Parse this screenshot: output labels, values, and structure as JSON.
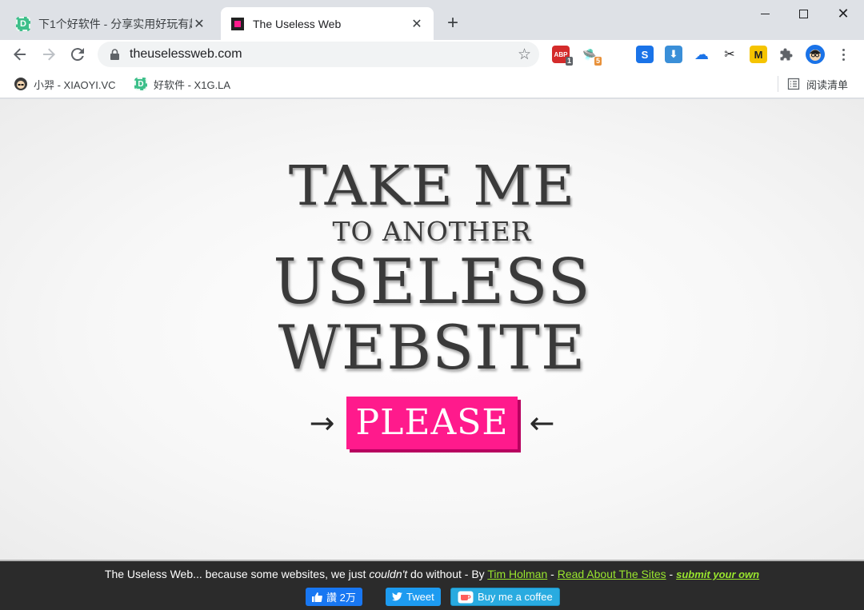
{
  "tabs": [
    {
      "title": "下1个好软件 - 分享实用好玩有趣",
      "active": false
    },
    {
      "title": "The Useless Web",
      "active": true
    }
  ],
  "address_bar": {
    "url": "theuselessweb.com"
  },
  "extensions": [
    {
      "name": "adblock-icon",
      "text": "ABP",
      "badge": "1",
      "color": "#d42b2b"
    },
    {
      "name": "ufo-extension-icon",
      "text": "🛸",
      "badge": "5",
      "color": "#ffffff"
    },
    {
      "name": "monkey-extension-icon",
      "text": "🐵",
      "badge": "",
      "color": "#ffffff"
    },
    {
      "name": "s-extension-icon",
      "text": "S",
      "badge": "",
      "color": "#1a73e8"
    },
    {
      "name": "download-extension-icon",
      "text": "⬇",
      "badge": "",
      "color": "#3a8fd8"
    },
    {
      "name": "cloud-extension-icon",
      "text": "☁",
      "badge": "",
      "color": "#ffffff"
    },
    {
      "name": "scissors-extension-icon",
      "text": "✂",
      "badge": "",
      "color": "#ffffff"
    },
    {
      "name": "m-extension-icon",
      "text": "M",
      "badge": "",
      "color": "#f5c400"
    },
    {
      "name": "puzzle-extensions-icon",
      "text": "🧩",
      "badge": "",
      "color": "#ffffff"
    }
  ],
  "bookmarks": [
    {
      "label": "小羿 - XIAOYI.VC"
    },
    {
      "label": "好软件 - X1G.LA"
    }
  ],
  "reading_list": {
    "label": "阅读清单"
  },
  "page": {
    "line1": "TAKE ME",
    "line2": "TO ANOTHER",
    "line3": "USELESS",
    "line4": "WEBSITE",
    "button": "PLEASE",
    "arrow_left": "→",
    "arrow_right": "←"
  },
  "footer": {
    "text_a": "The Useless Web... because some websites, we just ",
    "text_em": "couldn't",
    "text_b": " do without - By ",
    "author": "Tim Holman",
    "sep1": " - ",
    "about": "Read About The Sites",
    "sep2": " - ",
    "submit": "submit your own"
  },
  "social": {
    "like": "讚 2万",
    "tweet": "Tweet",
    "coffee": "Buy me a coffee"
  },
  "colors": {
    "accent_pink": "#ff1a8c",
    "footer_link": "#99e62e",
    "footer_bg": "#2b2b2b"
  }
}
